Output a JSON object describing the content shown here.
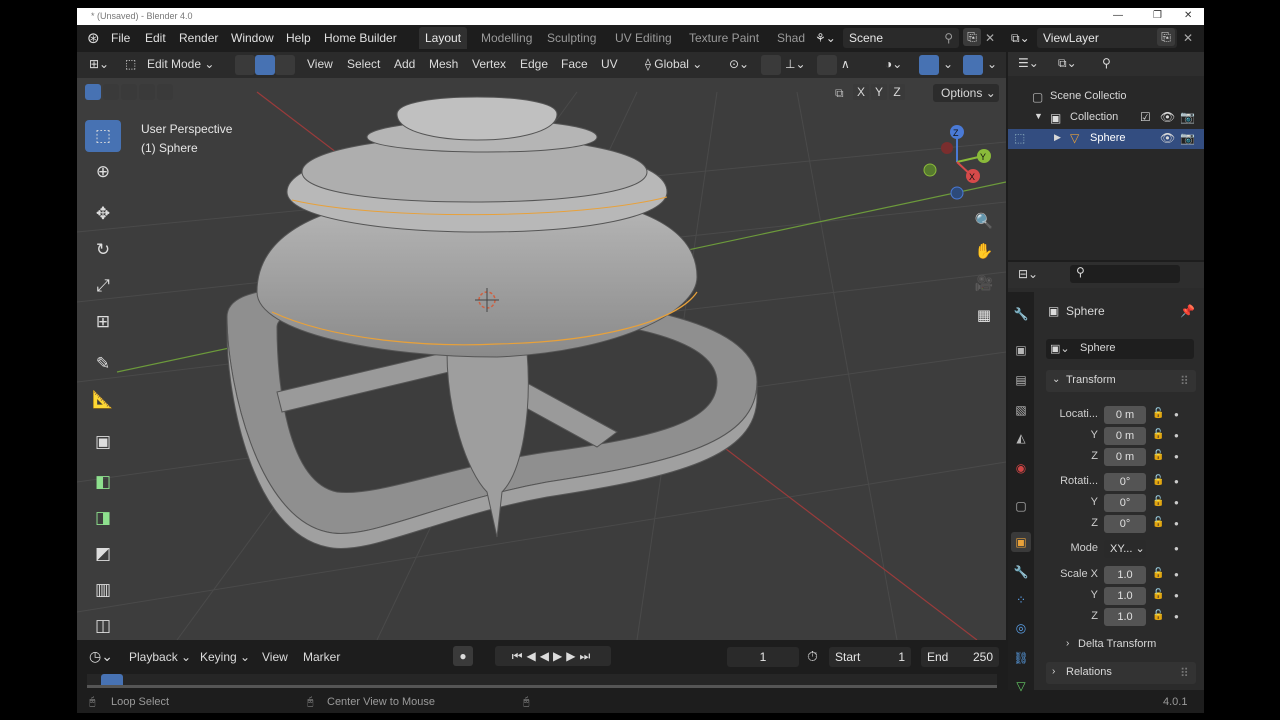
{
  "window": {
    "title": "* (Unsaved) - Blender 4.0",
    "controls": [
      "—",
      "❐",
      "✕"
    ]
  },
  "menus": [
    "File",
    "Edit",
    "Render",
    "Window",
    "Help",
    "Home Builder"
  ],
  "workspace_tabs": [
    "Layout",
    "Modelling",
    "Sculpting",
    "UV Editing",
    "Texture Paint",
    "Shad"
  ],
  "active_tab": "Layout",
  "scene": "Scene",
  "view_layer": "ViewLayer",
  "viewport_header": {
    "mode": "Edit Mode",
    "menus": [
      "View",
      "Select",
      "Add",
      "Mesh",
      "Vertex",
      "Edge",
      "Face",
      "UV"
    ],
    "orientation": "Global",
    "axes": [
      "X",
      "Y",
      "Z"
    ],
    "options": "Options"
  },
  "overlay": {
    "perspective": "User Perspective",
    "object": "(1) Sphere"
  },
  "gizmo": {
    "x": "X",
    "y": "Y",
    "z": "Z"
  },
  "outliner": {
    "items": [
      {
        "label": "Scene Collectio"
      },
      {
        "label": "Collection"
      },
      {
        "label": "Sphere"
      }
    ]
  },
  "properties": {
    "object_name": "Sphere",
    "datablock": "Sphere",
    "transform_header": "Transform",
    "location_label": "Locati...",
    "location": [
      "0 m",
      "0 m",
      "0 m"
    ],
    "rotation_label": "Rotati...",
    "rotation": [
      "0°",
      "0°",
      "0°"
    ],
    "mode_label": "Mode",
    "mode_value": "XY...",
    "scale_label": "Scale X",
    "scale": [
      "1.0",
      "1.0",
      "1.0"
    ],
    "axis_y": "Y",
    "axis_z": "Z",
    "delta": "Delta Transform",
    "relations": "Relations"
  },
  "timeline": {
    "menus": [
      "Playback",
      "Keying",
      "View",
      "Marker"
    ],
    "current_frame": "1",
    "start_label": "Start",
    "start": "1",
    "end_label": "End",
    "end": "250"
  },
  "status": {
    "left": "Loop Select",
    "middle": "Center View to Mouse",
    "version": "4.0.1"
  },
  "colors": {
    "accent": "#4772b3",
    "background": "#1d1d1d",
    "viewport": "#3d3d3d",
    "orange": "#e8a13a"
  }
}
